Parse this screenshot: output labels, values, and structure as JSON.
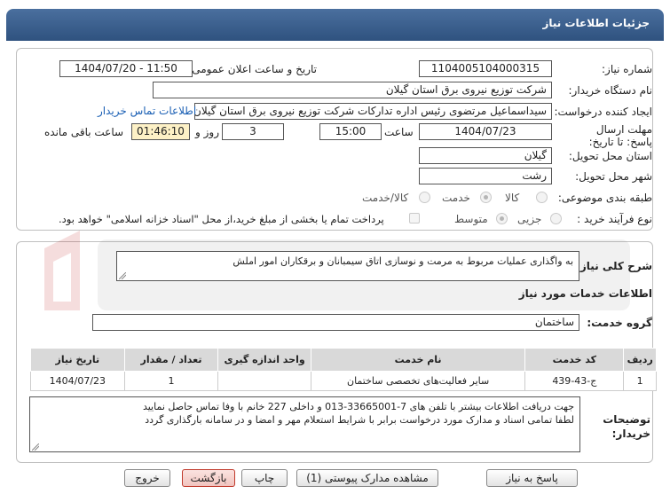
{
  "header": {
    "title": "جزئیات اطلاعات نیاز"
  },
  "fields": {
    "need_number_label": "شماره نیاز:",
    "need_number": "1104005104000315",
    "announce_label": "تاریخ و ساعت اعلان عمومی:",
    "announce_value": "1404/07/20 - 11:50",
    "buyer_label": "نام دستگاه خریدار:",
    "buyer_value": "شرکت توزیع نیروی برق استان گیلان",
    "creator_label": "ایجاد کننده درخواست:",
    "creator_value": "سیداسماعیل مرتضوی رئیس اداره تدارکات شرکت توزیع نیروی برق استان گیلان",
    "contact_link": "اطلاعات تماس خریدار",
    "deadline_label": "مهلت ارسال پاسخ: تا تاریخ:",
    "deadline_date": "1404/07/23",
    "time_label": "ساعت",
    "deadline_time": "15:00",
    "days_value": "3",
    "days_label": "روز و",
    "remaining_time": "01:46:10",
    "remaining_label": "ساعت باقی مانده",
    "province_label": "استان محل تحویل:",
    "province_value": "گیلان",
    "city_label": "شهر محل تحویل:",
    "city_value": "رشت",
    "category_label": "طبقه بندی موضوعی:",
    "category_options": [
      "کالا",
      "خدمت",
      "کالا/خدمت"
    ],
    "category_selected": "خدمت",
    "process_label": "نوع فرآیند خرید :",
    "process_options": [
      "جزیی",
      "متوسط"
    ],
    "process_selected": "متوسط",
    "payment_note": "پرداخت تمام یا بخشی از مبلغ خرید،از محل \"اسناد خزانه اسلامی\" خواهد بود."
  },
  "description": {
    "label": "شرح کلی نیاز:",
    "value": "به واگذاری عملیات مربوط به مرمت و نوسازی اتاق سیمبانان و برقکاران امور املش"
  },
  "services": {
    "section_title": "اطلاعات خدمات مورد نیاز",
    "group_label": "گروه خدمت:",
    "group_value": "ساختمان",
    "columns": [
      "ردیف",
      "کد خدمت",
      "نام خدمت",
      "واحد اندازه گیری",
      "تعداد / مقدار",
      "تاریخ نیاز"
    ],
    "rows": [
      [
        "1",
        "ج-43-439",
        "سایر فعالیت‌های تخصصی ساختمان",
        "",
        "1",
        "1404/07/23"
      ]
    ]
  },
  "buyer_notes": {
    "label": "توضیحات خریدار:",
    "line1": "جهت دریافت اطلاعات بیشتر با تلفن های 7-33665001-013 و داخلی 227 خانم با وفا تماس حاصل نمایید",
    "line2": "لطفا تمامی اسناد و مدارک مورد درخواست برابر با شرایط استعلام مهر و امضا و در سامانه بارگذاری گردد"
  },
  "buttons": {
    "reply": "پاسخ به نیاز",
    "attachments": "مشاهده مدارک پیوستی (1)",
    "print": "چاپ",
    "back": "بازگشت",
    "exit": "خروج"
  },
  "colors": {
    "header": "#3a5f8f",
    "link": "#1a5fb4",
    "remaining_bg": "#fdf1c6"
  }
}
